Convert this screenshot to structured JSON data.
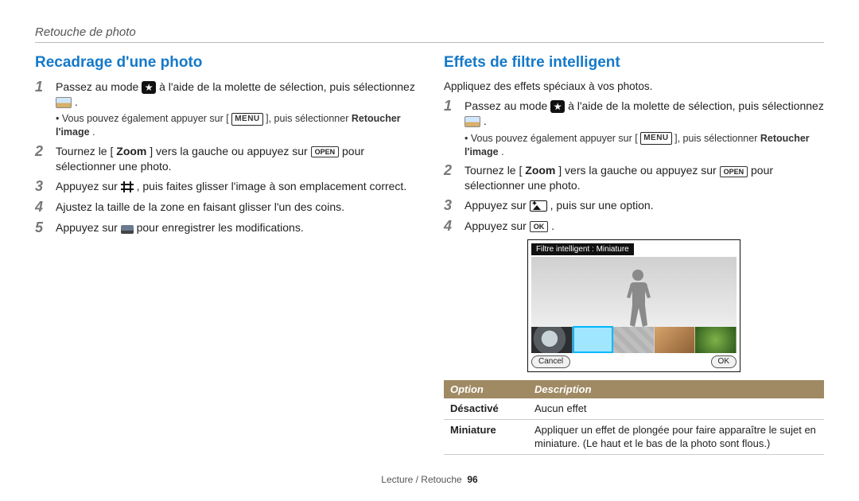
{
  "page": {
    "header": "Retouche de photo",
    "footer_section": "Lecture / Retouche",
    "footer_page": "96"
  },
  "left": {
    "heading": "Recadrage d'une photo",
    "steps": [
      {
        "pre": "Passez au mode ",
        "mid": " à l'aide de la molette de sélection, puis sélectionnez ",
        "post": ".",
        "note_pre": "Vous pouvez également appuyer sur [",
        "note_menu": "MENU",
        "note_mid": "], puis sélectionner ",
        "note_bold": "Retoucher l'image",
        "note_post": "."
      },
      {
        "pre": "Tournez le [",
        "zoom": "Zoom",
        "mid": "] vers la gauche ou appuyez sur ",
        "key": "OPEN",
        "post": " pour sélectionner une photo."
      },
      {
        "pre": "Appuyez sur ",
        "post": ", puis faites glisser l'image à son emplacement correct."
      },
      {
        "text": "Ajustez la taille de la zone en faisant glisser l'un des coins."
      },
      {
        "pre": "Appuyez sur ",
        "post": " pour enregistrer les modifications."
      }
    ]
  },
  "right": {
    "heading": "Effets de filtre intelligent",
    "intro": "Appliquez des effets spéciaux à vos photos.",
    "steps": [
      {
        "pre": "Passez au mode ",
        "mid": " à l'aide de la molette de sélection, puis sélectionnez ",
        "post": ".",
        "note_pre": "Vous pouvez également appuyer sur [",
        "note_menu": "MENU",
        "note_mid": "], puis sélectionner ",
        "note_bold": "Retoucher l'image",
        "note_post": "."
      },
      {
        "pre": "Tournez le [",
        "zoom": "Zoom",
        "mid": "] vers la gauche ou appuyez sur ",
        "key": "OPEN",
        "post": " pour sélectionner une photo."
      },
      {
        "pre": "Appuyez sur ",
        "post": ", puis sur une option."
      },
      {
        "pre": "Appuyez sur ",
        "key": "OK",
        "post": "."
      }
    ],
    "preview": {
      "banner": "Filtre intelligent : Miniature",
      "cancel": "Cancel",
      "ok": "OK"
    },
    "table": {
      "h_option": "Option",
      "h_desc": "Description",
      "rows": [
        {
          "k": "Désactivé",
          "v": "Aucun effet"
        },
        {
          "k": "Miniature",
          "v": "Appliquer un effet de plongée pour faire apparaître le sujet en miniature. (Le haut et le bas de la photo sont flous.)"
        }
      ]
    }
  }
}
